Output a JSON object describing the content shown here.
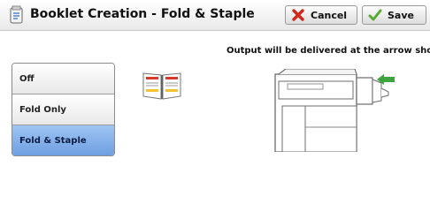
{
  "header": {
    "title": "Booklet Creation - Fold & Staple",
    "cancel_label": "Cancel",
    "save_label": "Save"
  },
  "instruction": "Output will be delivered at the arrow shown.",
  "options": [
    {
      "label": "Off",
      "selected": false
    },
    {
      "label": "Fold Only",
      "selected": false
    },
    {
      "label": "Fold & Staple",
      "selected": true
    }
  ],
  "icons": {
    "title": "booklet-feature-icon",
    "cancel": "red-x-icon",
    "save": "green-check-icon",
    "preview": "open-booklet-icon",
    "machine": "printer-finisher-icon",
    "output": "green-arrow-icon"
  },
  "colors": {
    "selected_option": "#7fadea",
    "output_arrow": "#3fa33f",
    "cancel_x": "#d0281c",
    "save_check": "#5aa832"
  }
}
